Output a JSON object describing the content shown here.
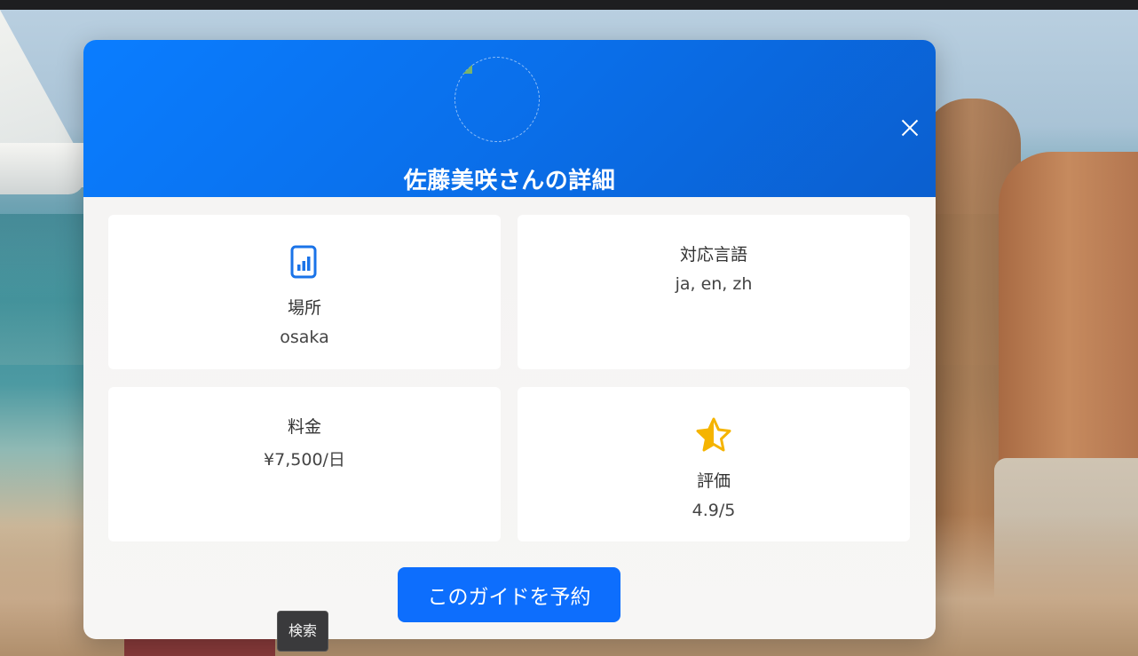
{
  "modal": {
    "title": "佐藤美咲さんの詳細",
    "close_icon": "close-icon",
    "avatar_state": "broken-image"
  },
  "details": {
    "location": {
      "icon": "bar-chart-icon",
      "label": "場所",
      "value": "osaka"
    },
    "languages": {
      "label": "対応言語",
      "value": "ja, en, zh"
    },
    "price": {
      "label": "料金",
      "value": "¥7,500/日"
    },
    "rating": {
      "icon": "star-half-icon",
      "label": "評価",
      "value": "4.9/5"
    }
  },
  "actions": {
    "book_label": "このガイドを予約"
  },
  "tooltip": {
    "text": "検索"
  },
  "colors": {
    "header_primary": "#0a7dff",
    "header_secondary": "#0b5fcf",
    "button": "#0d6efd",
    "icon_blue": "#1a73e8",
    "star": "#f5b400"
  }
}
